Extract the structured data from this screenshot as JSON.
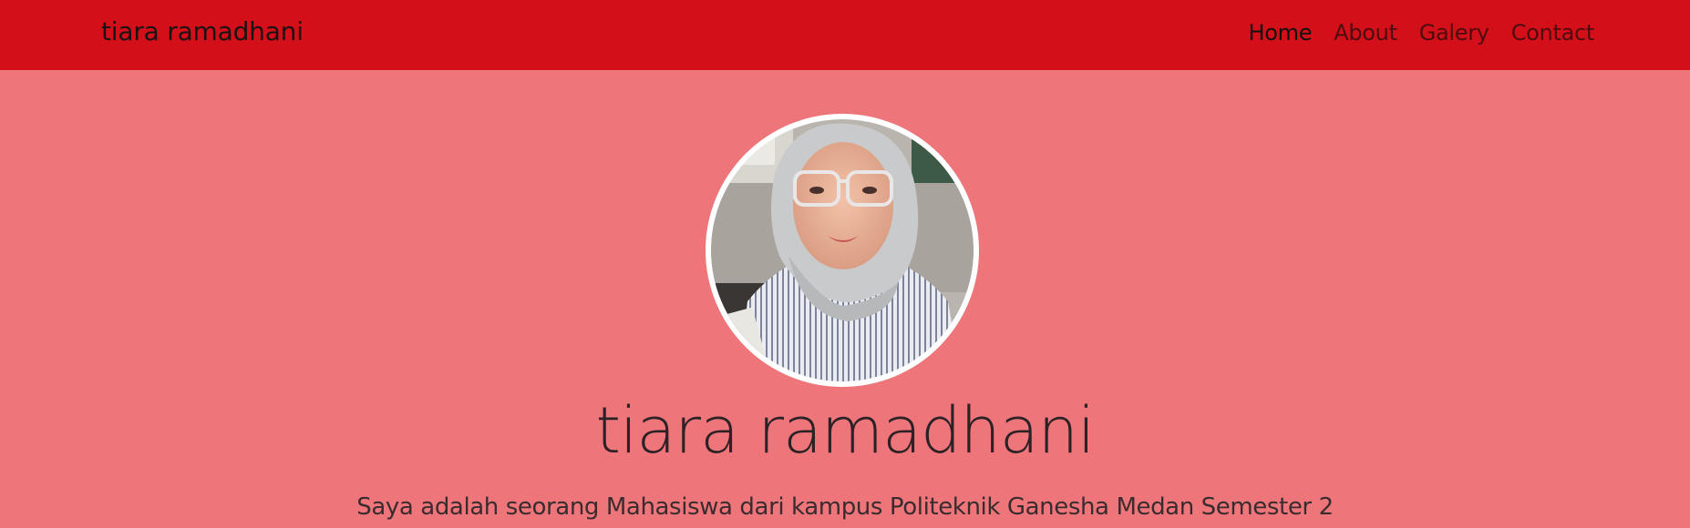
{
  "navbar": {
    "brand": "tiara ramadhani",
    "links": [
      {
        "label": "Home",
        "active": true
      },
      {
        "label": "About",
        "active": false
      },
      {
        "label": "Galery",
        "active": false
      },
      {
        "label": "Contact",
        "active": false
      }
    ]
  },
  "hero": {
    "title": "tiara ramadhani",
    "subtitle": "Saya adalah seorang Mahasiswa dari kampus Politeknik Ganesha Medan Semester 2"
  },
  "colors": {
    "navbar_bg": "#d30f19",
    "page_bg": "#ee767b",
    "avatar_ring": "#ffffff"
  }
}
